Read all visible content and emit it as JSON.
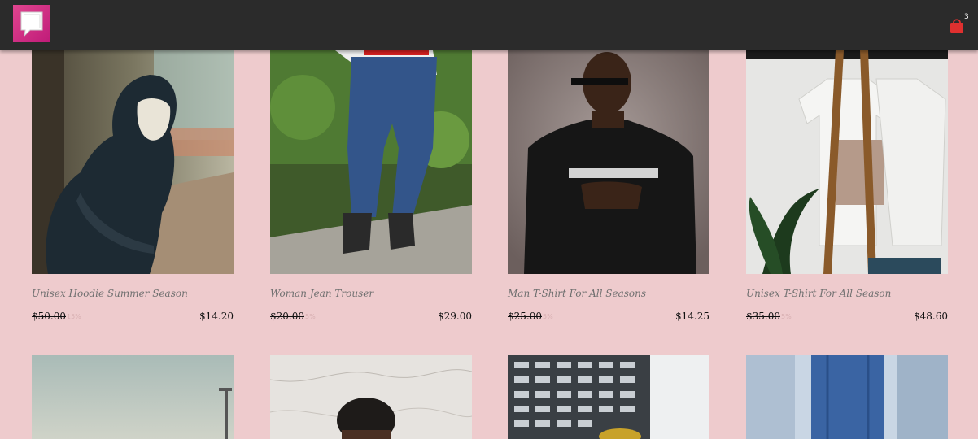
{
  "header": {
    "logo_icon": "chat-bubble-logo-icon",
    "cart_icon": "shopping-bag-icon",
    "cart_count": "3",
    "colors": {
      "bar": "#2b2b2b",
      "logo": "#d02f86",
      "cart": "#e0302f"
    }
  },
  "products": [
    {
      "name": "Unisex Hoodie Summer Season",
      "old_price": "$50.00",
      "discount": "15%",
      "price": "$14.20",
      "image": "hooded-masked-man-photo"
    },
    {
      "name": "Woman Jean Trouser",
      "old_price": "$20.00",
      "discount": "5%",
      "price": "$29.00",
      "image": "blue-jeans-photo"
    },
    {
      "name": "Man T-Shirt For All Seasons",
      "old_price": "$25.00",
      "discount": "5%",
      "price": "$14.25",
      "image": "man-black-tshirt-photo"
    },
    {
      "name": "Unisex T-Shirt For All Season",
      "old_price": "$35.00",
      "discount": "5%",
      "price": "$48.60",
      "image": "white-tshirt-rack-photo"
    },
    {
      "image": "sky-streetlight-photo"
    },
    {
      "image": "marble-wall-person-photo"
    },
    {
      "image": "building-facade-photo"
    },
    {
      "image": "denim-jacket-photo"
    }
  ],
  "colors": {
    "page_background": "#eecbcd",
    "discount_text": "#d8b0b2"
  }
}
